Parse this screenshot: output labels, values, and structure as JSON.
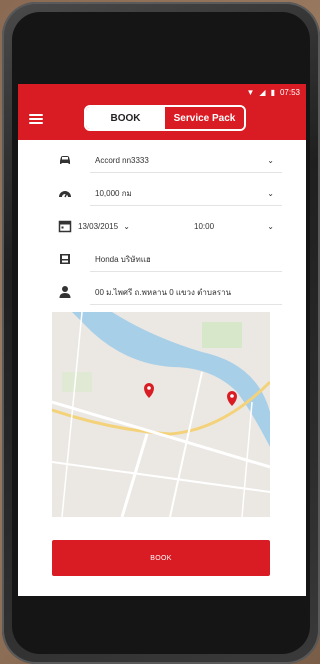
{
  "status_bar": {
    "time": "07:53"
  },
  "header": {
    "tab_book": "BOOK",
    "tab_service_pack": "Service Pack"
  },
  "form": {
    "car": "Accord nn3333",
    "mileage": "10,000 กม",
    "date": "13/03/2015",
    "time": "10:00",
    "dealer": "Honda บริษัทแฮ",
    "contact": "00 ม.ไพศรี ถ.พหลาน 0 แขวง ตำบลราน"
  },
  "book_button": {
    "label": "BOOK"
  },
  "colors": {
    "brand_red": "#d91c24",
    "map_water": "#a8cfe8",
    "map_pin": "#d91c24"
  },
  "icons": [
    "menu-icon",
    "car-icon",
    "speedometer-icon",
    "calendar-icon",
    "dealer-icon",
    "person-icon",
    "chevron-down-icon",
    "map-pin-icon"
  ]
}
